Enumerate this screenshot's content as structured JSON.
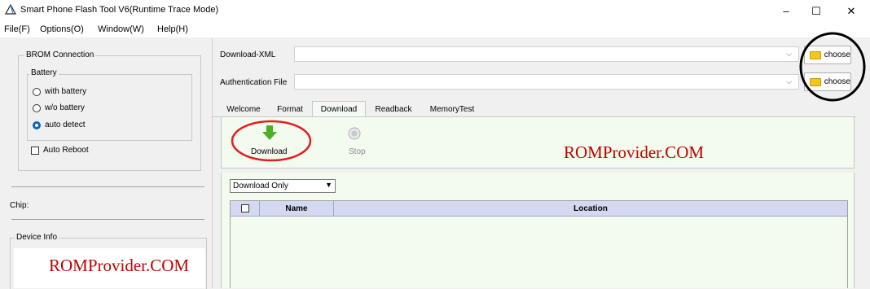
{
  "window": {
    "title": "Smart Phone Flash Tool V6(Runtime Trace Mode)",
    "controls": [
      "–",
      "☐",
      "✕"
    ]
  },
  "menu": [
    "File(F)",
    "Options(O)",
    "Window(W)",
    "Help(H)"
  ],
  "left": {
    "brom_title": "BROM Connection",
    "battery_title": "Battery",
    "radios": [
      {
        "label": "with battery",
        "checked": false
      },
      {
        "label": "w/o battery",
        "checked": false
      },
      {
        "label": "auto detect",
        "checked": true
      }
    ],
    "auto_reboot": "Auto Reboot",
    "chip_label": "Chip:",
    "device_info": "Device Info",
    "watermark": "ROMProvider.COM"
  },
  "right": {
    "download_xml_label": "Download-XML",
    "download_xml_value": "",
    "auth_label": "Authentication File",
    "auth_value": "",
    "choose_label": "choose",
    "tabs": [
      {
        "label": "Welcome",
        "active": false
      },
      {
        "label": "Format",
        "active": false
      },
      {
        "label": "Download",
        "active": true
      },
      {
        "label": "Readback",
        "active": false
      },
      {
        "label": "MemoryTest",
        "active": false
      }
    ],
    "download_button": "Download",
    "stop_button": "Stop",
    "watermark": "ROMProvider.COM",
    "mode_select": "Download Only",
    "table_headers": [
      "Name",
      "Location"
    ]
  },
  "colors": {
    "accent": "#0067c0",
    "annotation_red": "#e02020",
    "annotation_black": "#000000",
    "watermark_red": "#c00000",
    "panel_green": "#f3fbee",
    "header_blue": "#d4d8f0"
  },
  "icons": {
    "download": "download-arrow-icon",
    "stop": "stop-icon",
    "folder": "folder-icon",
    "app": "app-logo-icon"
  }
}
